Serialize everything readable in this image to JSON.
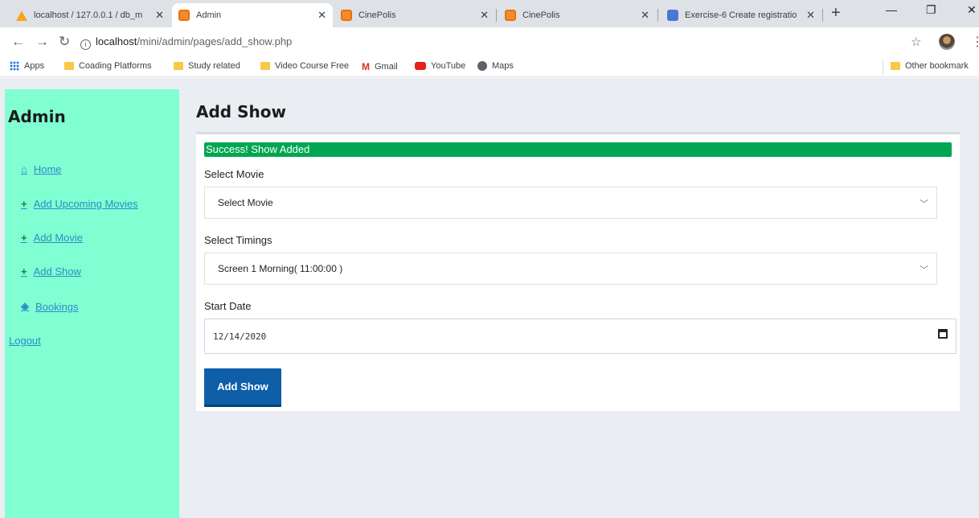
{
  "browser": {
    "tabs": [
      {
        "title": "localhost / 127.0.0.1 / db_m",
        "active": false
      },
      {
        "title": "Admin",
        "active": true
      },
      {
        "title": "CinePolis",
        "active": false
      },
      {
        "title": "CinePolis",
        "active": false
      },
      {
        "title": "Exercise-6 Create registratio",
        "active": false
      }
    ],
    "url_host": "localhost",
    "url_path": "/mini/admin/pages/add_show.php",
    "bookmarks": [
      {
        "label": "Apps",
        "icon": "apps-grid-icon"
      },
      {
        "label": "Coading Platforms",
        "icon": "folder-icon"
      },
      {
        "label": "Study related",
        "icon": "folder-icon"
      },
      {
        "label": "Video Course Free",
        "icon": "folder-icon"
      },
      {
        "label": "Gmail",
        "icon": "gmail-icon"
      },
      {
        "label": "YouTube",
        "icon": "youtube-icon"
      },
      {
        "label": "Maps",
        "icon": "maps-icon"
      }
    ],
    "other_bookmarks": "Other bookmark"
  },
  "sidebar": {
    "brand": "Admin",
    "items": [
      {
        "label": "Home",
        "icon": "home-icon"
      },
      {
        "label": "Add Upcoming Movies",
        "icon": "plus-icon"
      },
      {
        "label": "Add Movie",
        "icon": "plus-icon"
      },
      {
        "label": "Add Show",
        "icon": "plus-icon"
      },
      {
        "label": "Bookings",
        "icon": "tag-icon"
      }
    ],
    "logout": "Logout",
    "bg_color": "#80ffd2"
  },
  "main": {
    "title": "Add Show",
    "alert": "Success! Show Added",
    "alert_color": "#00a651",
    "movie_label": "Select Movie",
    "movie_value": "Select Movie",
    "timings_label": "Select Timings",
    "timings_value": "Screen 1 Morning( 11:00:00 )",
    "date_label": "Start Date",
    "date_value": "12/14/2020",
    "submit": "Add Show",
    "button_color": "#0e5ea8"
  }
}
